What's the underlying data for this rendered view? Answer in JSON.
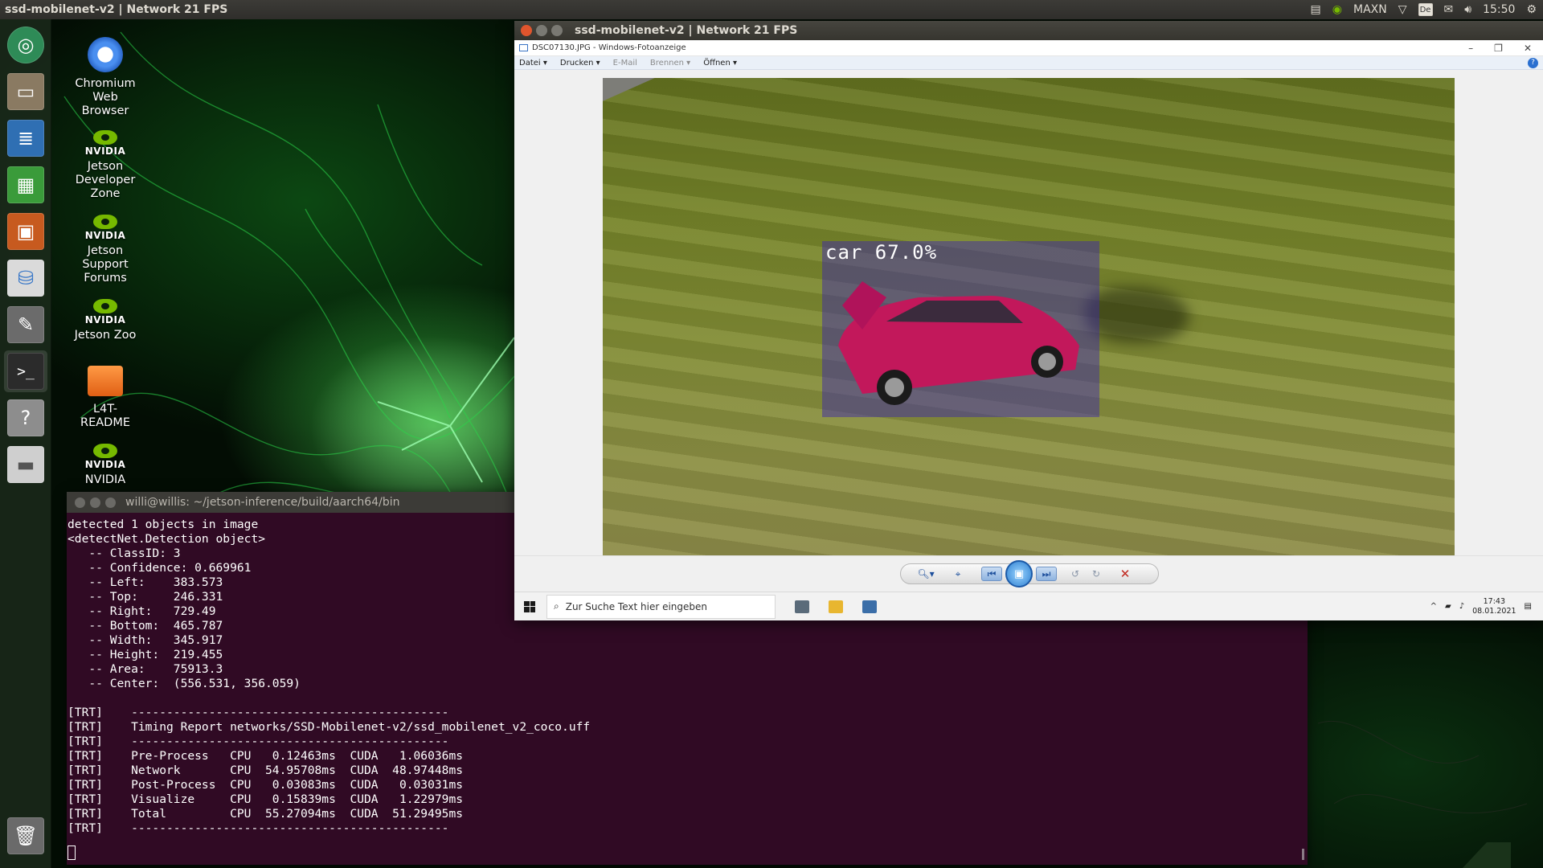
{
  "top_panel": {
    "title": "ssd-mobilenet-v2 | Network 21 FPS",
    "power_mode": "MAXN",
    "keyboard_layout": "De",
    "time": "15:50"
  },
  "launcher": {
    "items": [
      "Ubuntu Dash",
      "Files",
      "LibreOffice Writer",
      "LibreOffice Calc",
      "LibreOffice Impress",
      "Ubuntu Software",
      "System Settings",
      "Terminal",
      "Help",
      "Drive",
      "Trash"
    ]
  },
  "desktop_icons": [
    {
      "label": "Chromium\nWeb\nBrowser"
    },
    {
      "label": "Jetson\nDeveloper\nZone"
    },
    {
      "label": "Jetson\nSupport\nForums"
    },
    {
      "label": "Jetson Zoo"
    },
    {
      "label": "L4T-\nREADME"
    },
    {
      "label": "NVIDIA"
    }
  ],
  "nvidia_text": "NVIDIA",
  "detection_window": {
    "title": "ssd-mobilenet-v2 | Network 21 FPS",
    "viewer_title": "DSC07130.JPG - Windows-Fotoanzeige",
    "menu": [
      "Datei",
      "Drucken",
      "E-Mail",
      "Brennen",
      "Öffnen"
    ],
    "detection_label": "car 67.0%",
    "search_placeholder": "Zur Suche Text hier eingeben",
    "tray_time": "17:43",
    "tray_date": "08.01.2021"
  },
  "terminal": {
    "title": "willi@willis: ~/jetson-inference/build/aarch64/bin",
    "lines": [
      "detected 1 objects in image",
      "<detectNet.Detection object>",
      "   -- ClassID: 3",
      "   -- Confidence: 0.669961",
      "   -- Left:    383.573",
      "   -- Top:     246.331",
      "   -- Right:   729.49",
      "   -- Bottom:  465.787",
      "   -- Width:   345.917",
      "   -- Height:  219.455",
      "   -- Area:    75913.3",
      "   -- Center:  (556.531, 356.059)",
      "",
      "[TRT]    ---------------------------------------------",
      "[TRT]    Timing Report networks/SSD-Mobilenet-v2/ssd_mobilenet_v2_coco.uff",
      "[TRT]    ---------------------------------------------",
      "[TRT]    Pre-Process   CPU   0.12463ms  CUDA   1.06036ms",
      "[TRT]    Network       CPU  54.95708ms  CUDA  48.97448ms",
      "[TRT]    Post-Process  CPU   0.03083ms  CUDA   0.03031ms",
      "[TRT]    Visualize     CPU   0.15839ms  CUDA   1.22979ms",
      "[TRT]    Total         CPU  55.27094ms  CUDA  51.29495ms",
      "[TRT]    ---------------------------------------------"
    ]
  },
  "colors": {
    "terminal_bg": "#300a24",
    "nvidia_green": "#76b900",
    "bbox_fill": "#3c28aa"
  }
}
